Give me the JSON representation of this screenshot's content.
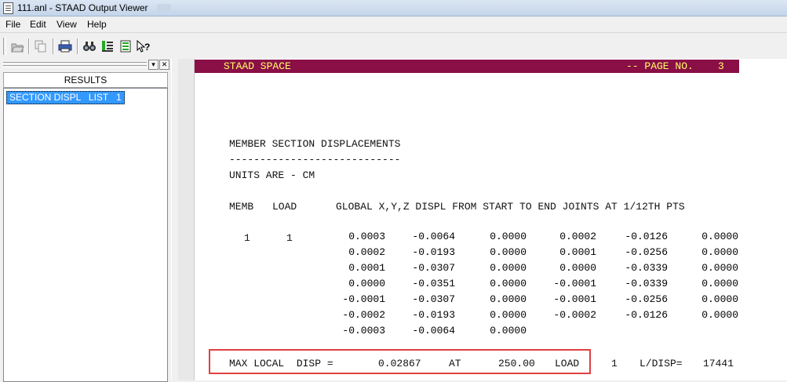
{
  "window": {
    "title": "111.anl - STAAD Output Viewer"
  },
  "menu": [
    "File",
    "Edit",
    "View",
    "Help"
  ],
  "toolbar": {
    "buttons": [
      "open-icon",
      "copy-icon",
      "print-icon",
      "find-icon",
      "goto-icon",
      "list-icon",
      "help-icon"
    ]
  },
  "left_pane": {
    "header": "RESULTS",
    "items": [
      "SECTION DISPL   LIST   1"
    ]
  },
  "page": {
    "header_left": "STAAD SPACE",
    "header_right": "-- PAGE NO.    3",
    "section_title": "MEMBER SECTION DISPLACEMENTS",
    "underline": "----------------------------",
    "units": "UNITS ARE - CM",
    "col_memb": "MEMB",
    "col_load": "LOAD",
    "col_desc": "GLOBAL X,Y,Z DISPL FROM START TO END JOINTS AT 1/12TH PTS",
    "memb": "1",
    "load": "1",
    "rows": [
      [
        "0.0003",
        "-0.0064",
        "0.0000",
        "0.0002",
        "-0.0126",
        "0.0000"
      ],
      [
        "0.0002",
        "-0.0193",
        "0.0000",
        "0.0001",
        "-0.0256",
        "0.0000"
      ],
      [
        "0.0001",
        "-0.0307",
        "0.0000",
        "0.0000",
        "-0.0339",
        "0.0000"
      ],
      [
        "0.0000",
        "-0.0351",
        "0.0000",
        "-0.0001",
        "-0.0339",
        "0.0000"
      ],
      [
        "-0.0001",
        "-0.0307",
        "0.0000",
        "-0.0001",
        "-0.0256",
        "0.0000"
      ],
      [
        "-0.0002",
        "-0.0193",
        "0.0000",
        "-0.0002",
        "-0.0126",
        "0.0000"
      ],
      [
        "-0.0003",
        "-0.0064",
        "0.0000",
        "",
        "",
        ""
      ]
    ],
    "max_line": {
      "label": "MAX LOCAL  DISP =",
      "value": "0.02867",
      "at_label": "AT",
      "at_value": "250.00",
      "load_label": "LOAD",
      "load_value": "1",
      "ldisp_label": "L/DISP=",
      "ldisp_value": "17441"
    }
  },
  "colors": {
    "page_header_bg": "#8a0f47",
    "page_header_text": "#ffff66",
    "highlight": "#e0403f",
    "selection": "#3399ff"
  }
}
